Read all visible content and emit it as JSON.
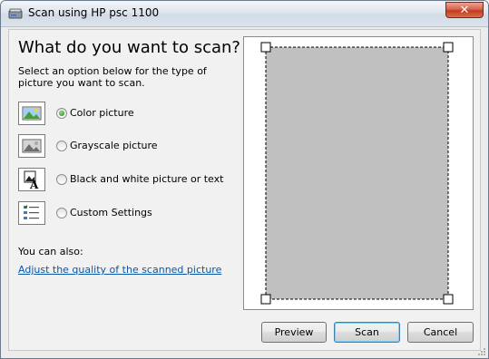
{
  "window": {
    "title": "Scan using HP psc 1100",
    "close_label": "✕"
  },
  "heading": "What do you want to scan?",
  "description": "Select an option below for the type of picture you want to scan.",
  "options": [
    {
      "label": "Color picture",
      "icon": "color-picture-icon",
      "selected": true
    },
    {
      "label": "Grayscale picture",
      "icon": "grayscale-picture-icon",
      "selected": false
    },
    {
      "label": "Black and white picture or text",
      "icon": "bw-text-icon",
      "selected": false
    },
    {
      "label": "Custom Settings",
      "icon": "custom-settings-icon",
      "selected": false
    }
  ],
  "also_label": "You can also:",
  "adjust_link": "Adjust the quality of the scanned picture",
  "buttons": {
    "preview": "Preview",
    "scan": "Scan",
    "cancel": "Cancel"
  },
  "colors": {
    "link": "#0b57a6",
    "close": "#c2391d",
    "scan_area": "#c0c0c0"
  }
}
